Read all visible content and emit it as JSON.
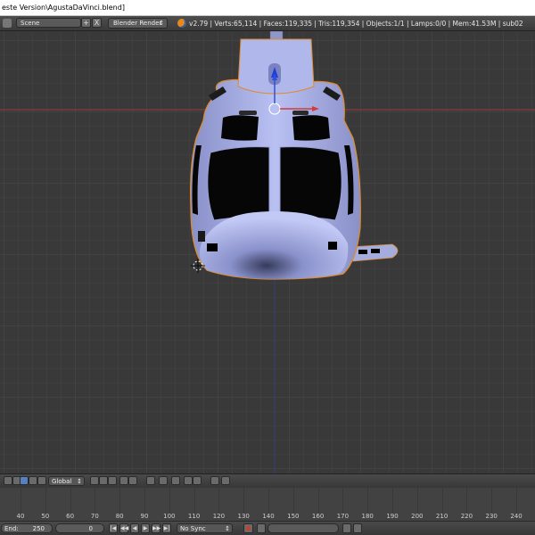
{
  "window": {
    "title": "este Version\\AgustaDaVinci.blend]"
  },
  "info_header": {
    "scene_name": "Scene",
    "scene_add": "+",
    "scene_remove": "X",
    "render_engine": "Blender Render",
    "stats": "v2.79 | Verts:65,114 | Faces:119,335 | Tris:119,354 | Objects:1/1 | Lamps:0/0 | Mem:41.53M | sub02"
  },
  "view3d_header": {
    "orientation": "Global"
  },
  "timeline": {
    "tick_labels": [
      "40",
      "50",
      "60",
      "70",
      "80",
      "90",
      "100",
      "110",
      "120",
      "130",
      "140",
      "150",
      "160",
      "170",
      "180",
      "190",
      "200",
      "210",
      "220",
      "230",
      "240"
    ]
  },
  "playback": {
    "end_label": "End:",
    "end_value": "250",
    "current_frame": "0",
    "sync_mode": "No Sync"
  },
  "colors": {
    "grid_bg": "#393939",
    "x_axis": "#a03a3a",
    "z_axis": "#2f3f86",
    "model_body": "#aab2ea",
    "selection_outline": "#e08a2a"
  }
}
